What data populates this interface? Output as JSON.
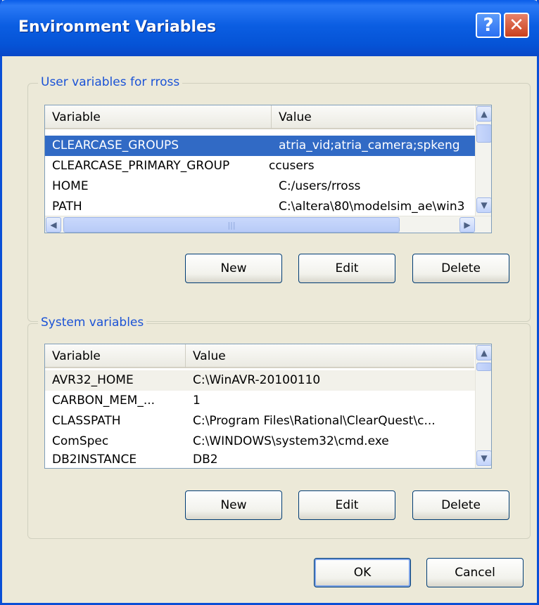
{
  "window": {
    "title": "Environment Variables",
    "help_glyph": "?",
    "close_glyph": "✕"
  },
  "user_vars": {
    "legend": "User variables for rross",
    "columns": [
      "Variable",
      "Value"
    ],
    "rows": [
      {
        "variable": "CLEARCASE_GROUPS",
        "value": "atria_vid;atria_camera;spkeng",
        "selected": true
      },
      {
        "variable": "CLEARCASE_PRIMARY_GROUP",
        "value": "ccusers"
      },
      {
        "variable": "HOME",
        "value": "C:/users/rross"
      },
      {
        "variable": "PATH",
        "value": "C:\\altera\\80\\modelsim_ae\\win3"
      }
    ],
    "buttons": {
      "new": "New",
      "edit": "Edit",
      "delete": "Delete"
    }
  },
  "system_vars": {
    "legend": "System variables",
    "columns": [
      "Variable",
      "Value"
    ],
    "rows": [
      {
        "variable": "AVR32_HOME",
        "value": "C:\\WinAVR-20100110",
        "hover": true
      },
      {
        "variable": "CARBON_MEM_...",
        "value": "1"
      },
      {
        "variable": "CLASSPATH",
        "value": "C:\\Program Files\\Rational\\ClearQuest\\c..."
      },
      {
        "variable": "ComSpec",
        "value": "C:\\WINDOWS\\system32\\cmd.exe"
      },
      {
        "variable": "DB2INSTANCE",
        "value": "DB2"
      }
    ],
    "buttons": {
      "new": "New",
      "edit": "Edit",
      "delete": "Delete"
    }
  },
  "footer": {
    "ok": "OK",
    "cancel": "Cancel"
  },
  "icons": {
    "scroll_up": "▲",
    "scroll_down": "▼",
    "scroll_left": "◀",
    "scroll_right": "▶",
    "grip": "|||"
  },
  "colors": {
    "title_bar": "#0a5de8",
    "selection": "#316ac5",
    "legend_text": "#1a52d6",
    "dialog_bg": "#ece9d8"
  }
}
